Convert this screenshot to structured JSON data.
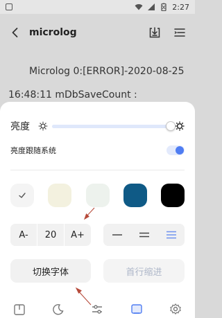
{
  "status_bar": {
    "time": "2:27"
  },
  "header": {
    "title": "microlog"
  },
  "log": {
    "line1": "Microlog 0:[ERROR]-2020-08-25",
    "line2": "16:48:11      mDbSaveCount :"
  },
  "settings": {
    "brightness_label": "亮度",
    "brightness_level": 1.0,
    "follow_system_label": "亮度跟随系统",
    "follow_system_on": true,
    "themes": [
      {
        "color": "#f4f4f4",
        "selected": true
      },
      {
        "color": "#f3f1df",
        "selected": false
      },
      {
        "color": "#edf2ed",
        "selected": false
      },
      {
        "color": "#0f5a86",
        "selected": false
      },
      {
        "color": "#000000",
        "selected": false
      }
    ],
    "font_size": {
      "decrease": "A-",
      "value": "20",
      "increase": "A+"
    },
    "switch_font_label": "切换字体",
    "first_line_indent_label": "首行缩进"
  },
  "colors": {
    "accent": "#4f7df2",
    "annotation_arrow": "#b64a3a"
  }
}
